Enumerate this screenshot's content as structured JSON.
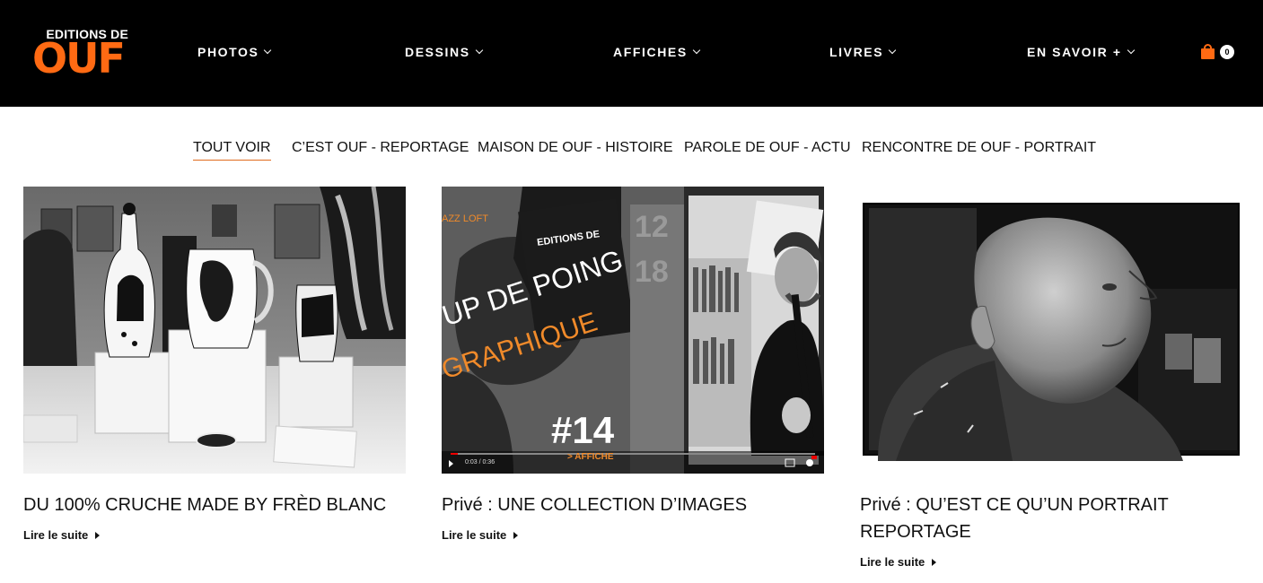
{
  "brand": {
    "top": "EDITIONS DE",
    "main": "OUF",
    "accent": "#ff6a13"
  },
  "nav": [
    {
      "label": "PHOTOS"
    },
    {
      "label": "DESSINS"
    },
    {
      "label": "AFFICHES"
    },
    {
      "label": "LIVRES"
    },
    {
      "label": "EN SAVOIR +"
    }
  ],
  "cart": {
    "count": "0",
    "icon": "shopping-bag-icon"
  },
  "filters": {
    "active": "TOUT VOIR",
    "items": [
      {
        "label": "TOUT VOIR"
      },
      {
        "label": "C’EST OUF - REPORTAGE"
      },
      {
        "label": "MAISON DE OUF - HISTOIRE"
      },
      {
        "label": "PAROLE DE OUF - ACTU"
      },
      {
        "label": "RENCONTRE DE OUF - PORTRAIT"
      }
    ]
  },
  "posts": [
    {
      "title": "DU 100% CRUCHE MADE BY FRÈD BLANC",
      "read_more": "Lire le suite"
    },
    {
      "title": "Privé : UNE COLLECTION D’IMAGES",
      "read_more": "Lire le suite",
      "video": {
        "logo_top": "EDITIONS DE",
        "venue": "AZZ LOFT",
        "line1": "UP DE POING",
        "line2": "GRAPHIQUE",
        "number": "#14",
        "tag": "> AFFICHE",
        "time": "0:03 / 0:36",
        "date_a": "12",
        "date_b": "18"
      }
    },
    {
      "title": "Privé : QU’EST CE QU’UN PORTRAIT REPORTAGE",
      "read_more": "Lire le suite"
    }
  ]
}
